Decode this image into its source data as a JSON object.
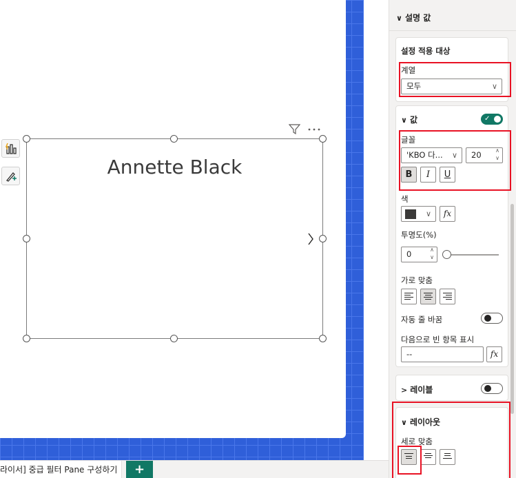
{
  "canvas": {
    "card_value": "Annette Black",
    "filter_icon": "filter-icon",
    "more_icon": "more-options-icon",
    "next_icon": "chevron-right-icon"
  },
  "side_tools": [
    {
      "icon": "insights-icon"
    },
    {
      "icon": "format-painter-icon"
    }
  ],
  "bottom_bar": {
    "page_tab_label": "라이서] 중급 필터 Pane 구성하기",
    "add_page_label": "+"
  },
  "format_pane": {
    "description_header": "설명 값",
    "apply_to": {
      "title": "설정 적용 대상",
      "series_label": "계열",
      "series_value": "모두"
    },
    "values_section": {
      "header": "값",
      "toggle": "on",
      "font_label": "글꼴",
      "font_family": "'KBO 다...",
      "font_size": "20",
      "bold": "B",
      "italic": "I",
      "underline": "U",
      "color_label": "색",
      "color_value": "#3b3a39",
      "fx": "fx",
      "transparency_label": "투명도(%)",
      "transparency_value": "0",
      "h_align_label": "가로 맞춤",
      "wrap_label": "자동 줄 바꿈",
      "wrap_toggle": "off",
      "blank_label": "다음으로 빈 항목 표시",
      "blank_value": "--"
    },
    "label_section": {
      "header": "레이블",
      "toggle": "off"
    },
    "layout_section": {
      "header": "레이아웃",
      "v_align_label": "세로 맞춤"
    }
  },
  "colors": {
    "accent": "#117865",
    "highlight": "#e81123",
    "canvas_bg": "#2f5fd9"
  }
}
